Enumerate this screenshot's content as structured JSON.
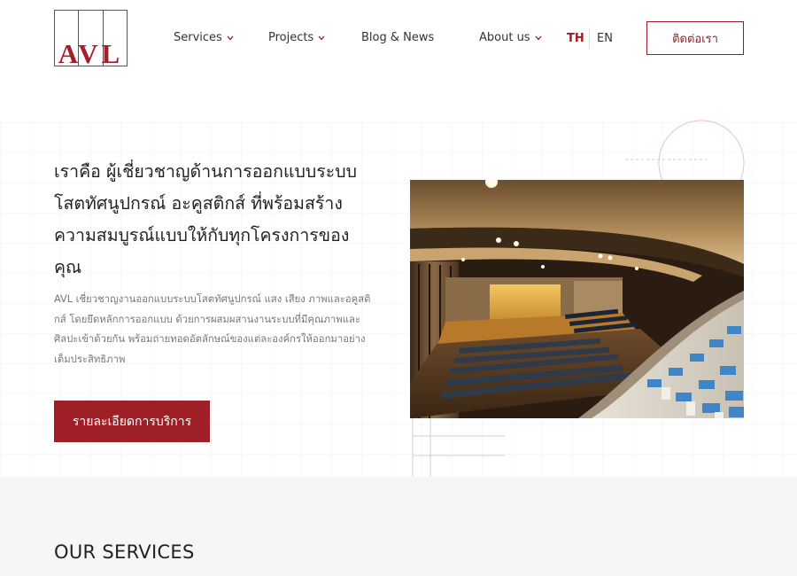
{
  "header": {
    "logo_text": "AVL",
    "nav": [
      {
        "label": "Services",
        "has_dropdown": true
      },
      {
        "label": "Projects",
        "has_dropdown": true
      },
      {
        "label": "Blog & News",
        "has_dropdown": false
      },
      {
        "label": "About us",
        "has_dropdown": true
      }
    ],
    "lang": {
      "active": "TH",
      "other": "EN"
    },
    "contact_label": "ติดต่อเรา"
  },
  "hero": {
    "title": "เราคือ ผู้เชี่ยวชาญด้านการออกแบบระบบโสตทัศนูปกรณ์ อะคูสติกส์ ที่พร้อมสร้างความสมบูรณ์แบบให้กับทุกโครงการของคุณ",
    "description": "AVL เชี่ยวชาญงานออกแบบระบบโสตทัศนูปกรณ์ แสง เสียง ภาพและอคูสติกส์ โดยยึดหลักการออกแบบ ด้วยการผสมผสานงานระบบที่มีคุณภาพและศิลปะเข้าด้วยกัน พร้อมถ่ายทอดอัตลักษณ์ของแต่ละองค์กรให้ออกมาอย่างเต็มประสิทธิภาพ",
    "cta_label": "รายละเอียดการบริการ",
    "image_alt": "auditorium-photo"
  },
  "services": {
    "title": "OUR SERVICES"
  },
  "colors": {
    "brand_red": "#9e2026",
    "text_dark": "#222222",
    "text_muted": "#777777",
    "section_bg": "#f6f6f6"
  }
}
